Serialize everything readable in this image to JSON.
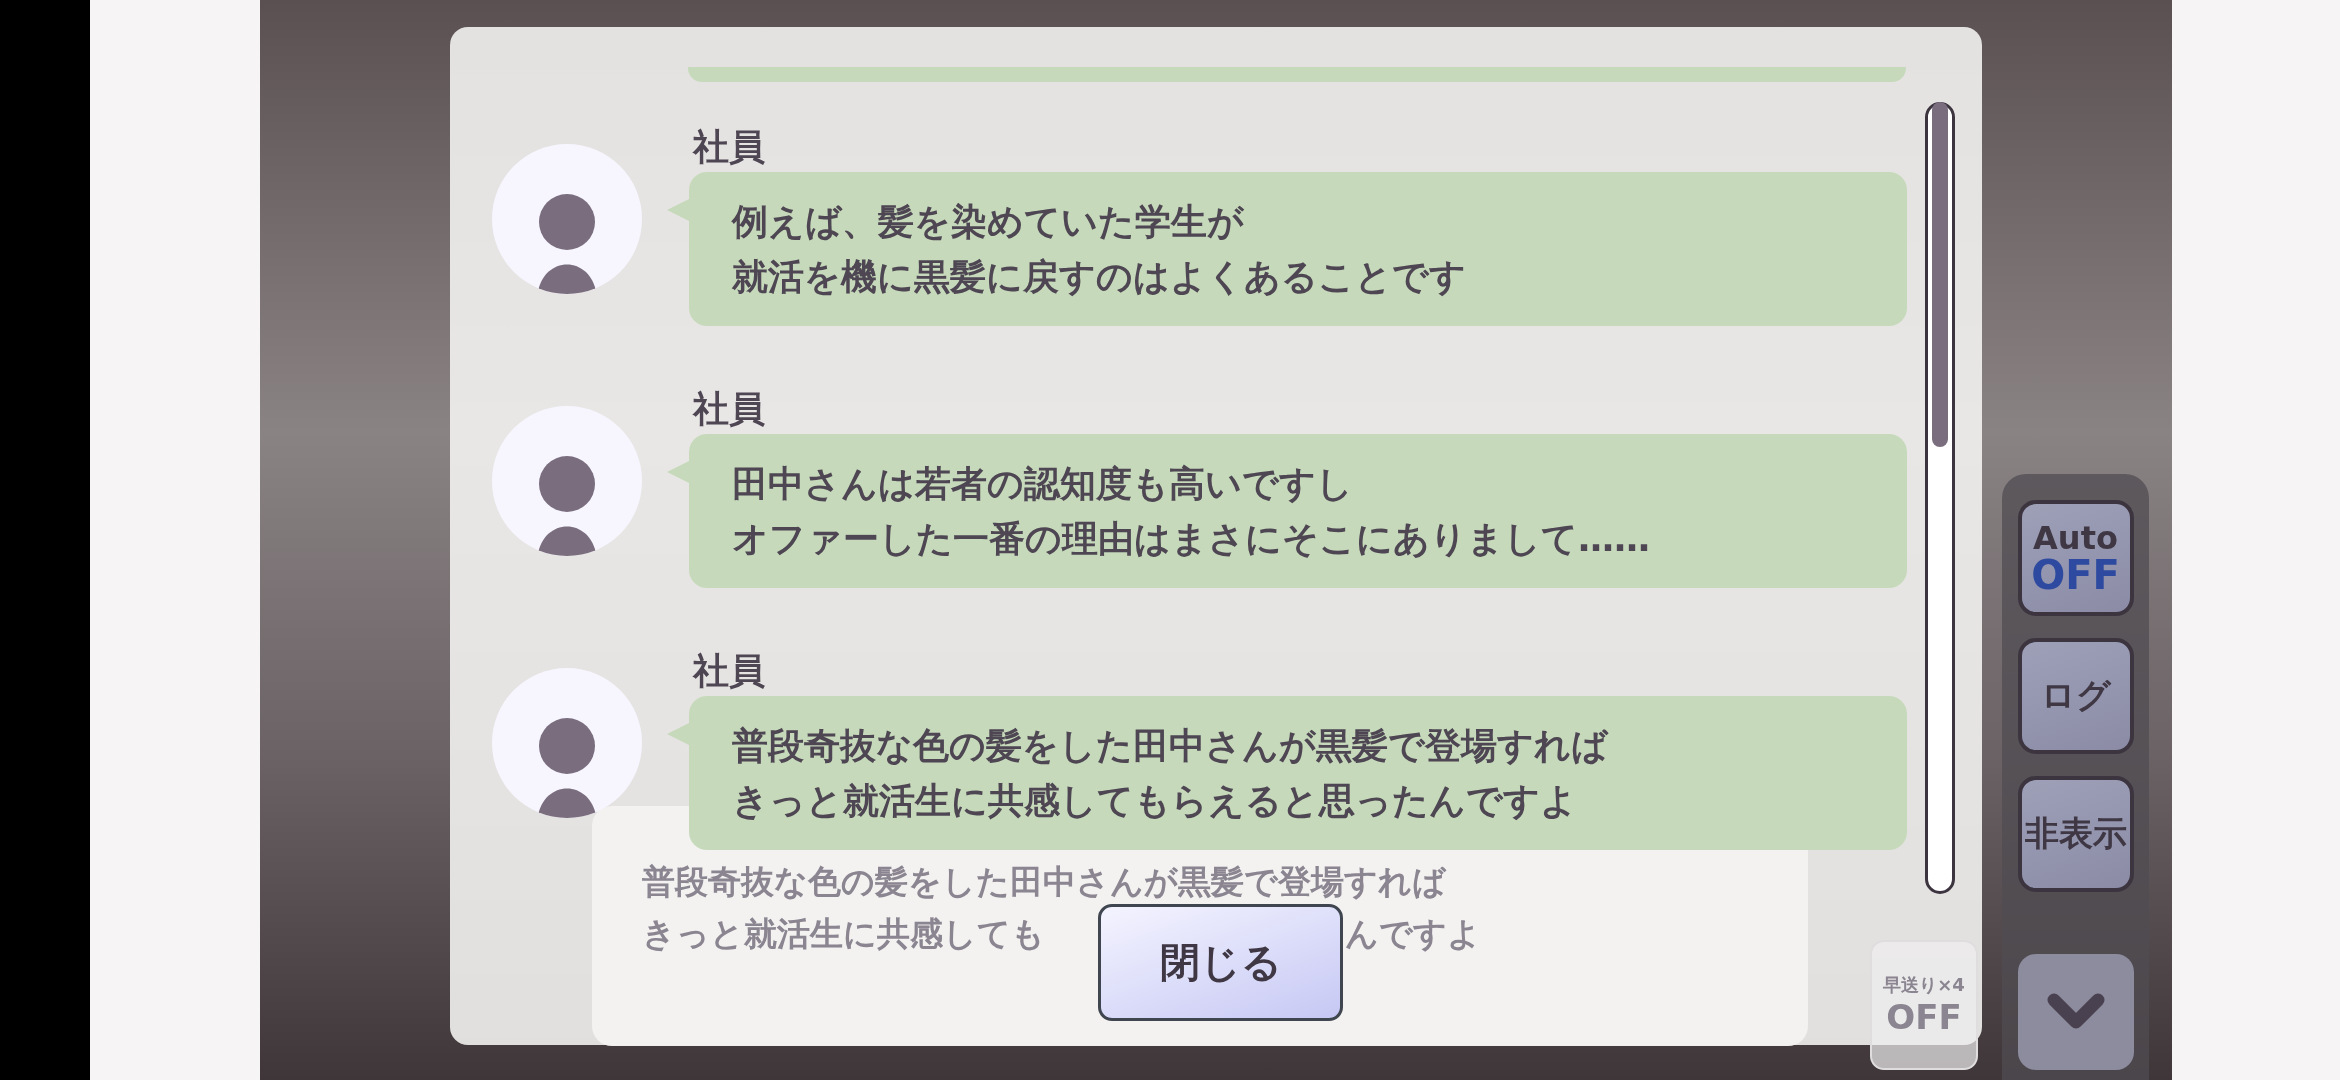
{
  "background_message": {
    "lines": [
      "普段奇抜な色の髪をした田中さんが黒髪で登場すれば",
      "きっと就活生に共感しても",
      "んですよ"
    ]
  },
  "fast_forward_button": {
    "label": "早送り×4",
    "value": "OFF"
  },
  "side_controls": {
    "auto": {
      "label": "Auto",
      "value": "OFF",
      "on": false
    },
    "log_label": "ログ",
    "hide_label": "非表示"
  },
  "log_dialog": {
    "messages": [
      {
        "speaker": "社員",
        "lines": [
          "例えば、髪を染めていた学生が",
          "就活を機に黒髪に戻すのはよくあることです"
        ]
      },
      {
        "speaker": "社員",
        "lines": [
          "田中さんは若者の認知度も高いですし",
          "オファーした一番の理由はまさにそこにありまして……"
        ]
      },
      {
        "speaker": "社員",
        "lines": [
          "普段奇抜な色の髪をした田中さんが黒髪で登場すれば",
          "きっと就活生に共感してもらえると思ったんですよ"
        ]
      }
    ],
    "close_button": "閉じる"
  }
}
